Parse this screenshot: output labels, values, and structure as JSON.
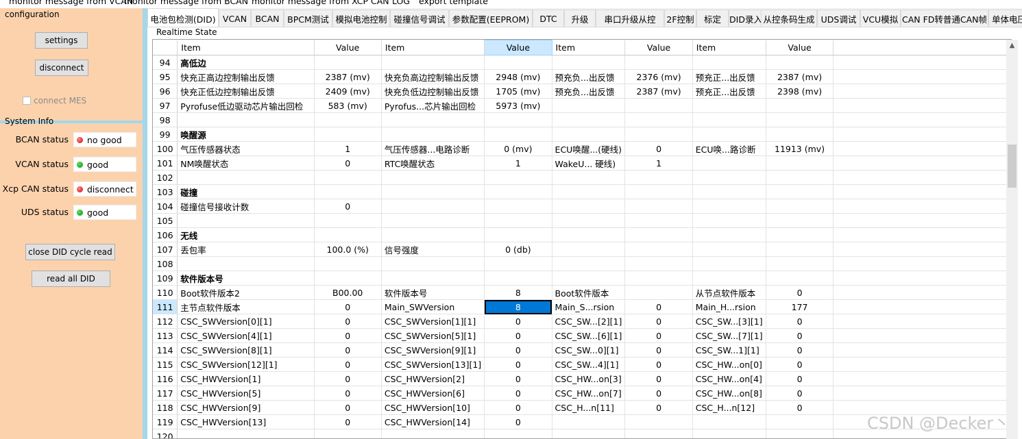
{
  "menu": [
    "monitor message from VCAN",
    "monitor message from BCAN",
    "monitor message from XCP CAN",
    "LOG",
    "export template"
  ],
  "left": {
    "configuration": "configuration",
    "settings": "settings",
    "disconnect": "disconnect",
    "connect_mes": "connect MES",
    "system_info": "System Info",
    "status": [
      {
        "label": "BCAN status",
        "value": "no good",
        "color": "red"
      },
      {
        "label": "VCAN status",
        "value": "good",
        "color": "green"
      },
      {
        "label": "Xcp CAN status",
        "value": "disconnect",
        "color": "red"
      },
      {
        "label": "UDS status",
        "value": "good",
        "color": "green"
      }
    ],
    "close_did": "close DID cycle read",
    "read_all": "read all DID"
  },
  "tabs": [
    "电池包检测(DID)",
    "VCAN",
    "BCAN",
    "BPCM测试",
    "模拟电池控制",
    "碰撞信号调试",
    "参数配置(EEPROM)",
    "DTC",
    "升级",
    "串口升级从控",
    "2F控制",
    "标定",
    "DID录入",
    "从控条码生成",
    "UDS调试",
    "VCU模拟",
    "CAN FD转普通CAN帧",
    "单体电压"
  ],
  "realtime_label": "Realtime State",
  "grid": {
    "headers": [
      "Item",
      "Value",
      "Item",
      "Value",
      "Item",
      "Value",
      "Item",
      "Value"
    ],
    "rows": [
      {
        "n": "94",
        "h": "高低边"
      },
      {
        "n": "95",
        "c": [
          "快充正高边控制输出反馈",
          "2387 (mv)",
          "快充负高边控制输出反馈",
          "2948 (mv)",
          "预充负...出反馈",
          "2376 (mv)",
          "预充正...出反馈",
          "2387 (mv)"
        ]
      },
      {
        "n": "96",
        "c": [
          "快充正低边控制输出反馈",
          "2409 (mv)",
          "快充负低边控制输出反馈",
          "1705 (mv)",
          "预充负...出反馈",
          "2387 (mv)",
          "预充正...出反馈",
          "2398 (mv)"
        ]
      },
      {
        "n": "97",
        "c": [
          "Pyrofuse低边驱动芯片输出回检",
          "583 (mv)",
          "Pyrofus...芯片输出回检",
          "5973 (mv)",
          "",
          "",
          "",
          ""
        ]
      },
      {
        "n": "98",
        "c": [
          "",
          "",
          "",
          "",
          "",
          "",
          "",
          ""
        ]
      },
      {
        "n": "99",
        "h": "唤醒源"
      },
      {
        "n": "100",
        "c": [
          "气压传感器状态",
          "1",
          "气压传感器...电路诊断",
          "0 (mv)",
          "ECU唤醒...(硬线)",
          "0",
          "ECU唤...路诊断",
          "11913 (mv)"
        ]
      },
      {
        "n": "101",
        "c": [
          "NM唤醒状态",
          "0",
          "RTC唤醒状态",
          "1",
          "WakeU... 硬线)",
          "1",
          "",
          ""
        ]
      },
      {
        "n": "102",
        "c": [
          "",
          "",
          "",
          "",
          "",
          "",
          "",
          ""
        ]
      },
      {
        "n": "103",
        "h": "碰撞"
      },
      {
        "n": "104",
        "c": [
          "碰撞信号接收计数",
          "0",
          "",
          "",
          "",
          "",
          "",
          ""
        ]
      },
      {
        "n": "105",
        "c": [
          "",
          "",
          "",
          "",
          "",
          "",
          "",
          ""
        ]
      },
      {
        "n": "106",
        "h": "无线"
      },
      {
        "n": "107",
        "c": [
          "丢包率",
          "100.0 (%)",
          "信号强度",
          "0 (db)",
          "",
          "",
          "",
          ""
        ]
      },
      {
        "n": "108",
        "c": [
          "",
          "",
          "",
          "",
          "",
          "",
          "",
          ""
        ]
      },
      {
        "n": "109",
        "h": "软件版本号"
      },
      {
        "n": "110",
        "c": [
          "Boot软件版本2",
          "B00.00",
          "软件版本号",
          "8",
          "Boot软件版本",
          "",
          "从节点软件版本",
          "0"
        ]
      },
      {
        "n": "111",
        "sel": true,
        "c": [
          "主节点软件版本",
          "0",
          "Main_SWVersion",
          "8",
          "Main_S...rsion",
          "0",
          "Main_H...rsion",
          "177"
        ]
      },
      {
        "n": "112",
        "c": [
          "CSC_SWVersion[0][1]",
          "0",
          "CSC_SWVersion[1][1]",
          "0",
          "CSC_SW...[2][1]",
          "0",
          "CSC_SW...[3][1]",
          "0"
        ]
      },
      {
        "n": "113",
        "c": [
          "CSC_SWVersion[4][1]",
          "0",
          "CSC_SWVersion[5][1]",
          "0",
          "CSC_SW...[6][1]",
          "0",
          "CSC_SW...[7][1]",
          "0"
        ]
      },
      {
        "n": "114",
        "c": [
          "CSC_SWVersion[8][1]",
          "0",
          "CSC_SWVersion[9][1]",
          "0",
          "CSC_SW...0][1]",
          "0",
          "CSC_SW...1][1]",
          "0"
        ]
      },
      {
        "n": "115",
        "c": [
          "CSC_SWVersion[12][1]",
          "0",
          "CSC_SWVersion[13][1]",
          "0",
          "CSC_SW...4][1]",
          "0",
          "CSC_HW...on[0]",
          "0"
        ]
      },
      {
        "n": "116",
        "c": [
          "CSC_HWVersion[1]",
          "0",
          "CSC_HWVersion[2]",
          "0",
          "CSC_HW...on[3]",
          "0",
          "CSC_HW...on[4]",
          "0"
        ]
      },
      {
        "n": "117",
        "c": [
          "CSC_HWVersion[5]",
          "0",
          "CSC_HWVersion[6]",
          "0",
          "CSC_HW...on[7]",
          "0",
          "CSC_HW...on[8]",
          "0"
        ]
      },
      {
        "n": "118",
        "c": [
          "CSC_HWVersion[9]",
          "0",
          "CSC_HWVersion[10]",
          "0",
          "CSC_H...n[11]",
          "0",
          "CSC_H...n[12]",
          "0"
        ]
      },
      {
        "n": "119",
        "c": [
          "CSC_HWVersion[13]",
          "0",
          "CSC_HWVersion[14]",
          "0",
          "",
          "",
          "",
          ""
        ]
      },
      {
        "n": "120",
        "c": [
          "",
          "",
          "",
          "",
          "",
          "",
          "",
          ""
        ]
      }
    ]
  },
  "watermark": "CSDN @Decker丶"
}
